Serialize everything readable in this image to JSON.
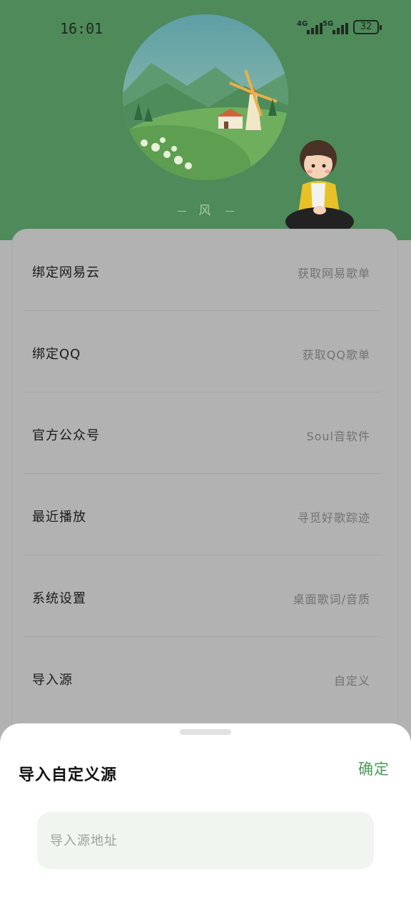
{
  "status_bar": {
    "time": "16:01",
    "network_1": "4G",
    "network_2": "5G",
    "battery": "32"
  },
  "profile": {
    "name": "风"
  },
  "menu": [
    {
      "title": "绑定网易云",
      "subtitle": "获取网易歌单"
    },
    {
      "title": "绑定QQ",
      "subtitle": "获取QQ歌单"
    },
    {
      "title": "官方公众号",
      "subtitle": "Soul音软件"
    },
    {
      "title": "最近播放",
      "subtitle": "寻觅好歌踪迹"
    },
    {
      "title": "系统设置",
      "subtitle": "桌面歌词/音质"
    },
    {
      "title": "导入源",
      "subtitle": "自定义"
    }
  ],
  "sheet": {
    "title": "导入自定义源",
    "confirm_label": "确定",
    "input_placeholder": "导入源地址",
    "input_value": ""
  },
  "colors": {
    "header": "#4e8a5a",
    "accent": "#4c9a58",
    "overlay_gray": "#b2b2b2",
    "input_bg": "#f1f5f0"
  }
}
